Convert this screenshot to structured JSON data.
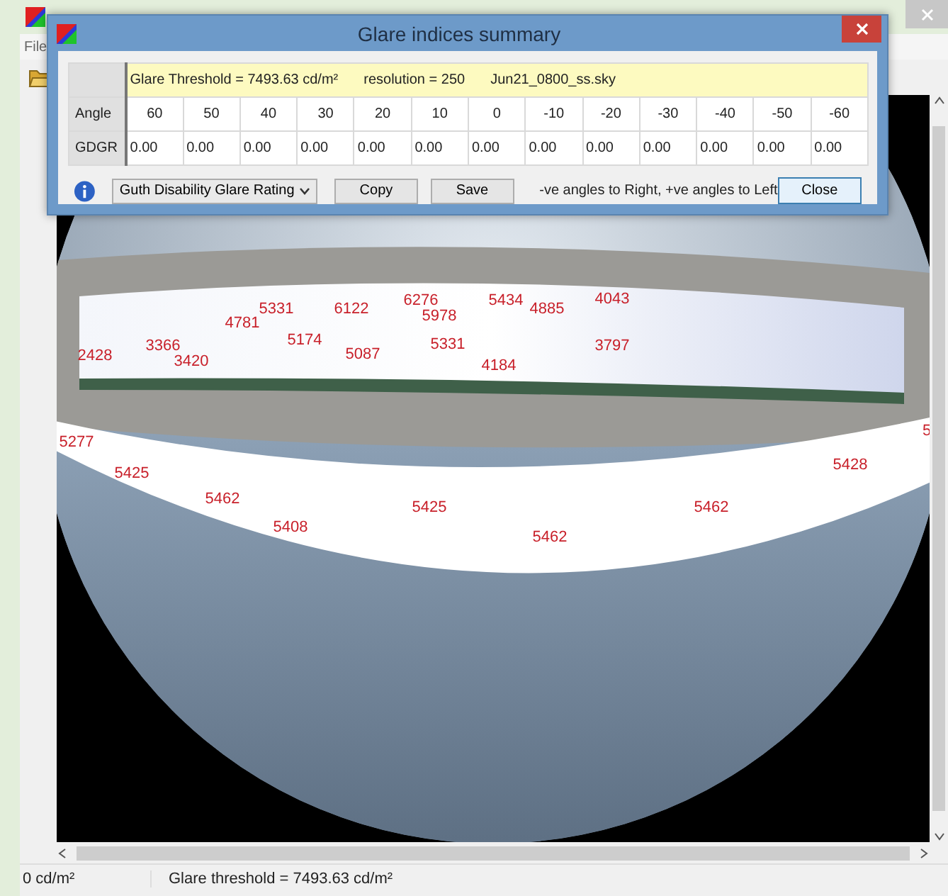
{
  "main_window": {
    "menu": [
      "File"
    ],
    "status_bar": [
      "0 cd/m²",
      "Glare threshold = 7493.63 cd/m²"
    ]
  },
  "fisheye": {
    "labels": [
      "6276",
      "5434",
      "4043",
      "5331",
      "6122",
      "4885",
      "5978",
      "4781",
      "5174",
      "3366",
      "5331",
      "3797",
      "2428",
      "5087",
      "3420",
      "4184",
      "5",
      "5277",
      "5428",
      "5425",
      "5462",
      "5425",
      "5462",
      "5408",
      "5462"
    ]
  },
  "dialog": {
    "title": "Glare indices summary",
    "info": [
      "Glare Threshold = 7493.63 cd/m²",
      "resolution = 250",
      "Jun21_0800_ss.sky"
    ],
    "rows": [
      {
        "header": "Angle",
        "cells": [
          "60",
          "50",
          "40",
          "30",
          "20",
          "10",
          "0",
          "-10",
          "-20",
          "-30",
          "-40",
          "-50",
          "-60"
        ]
      },
      {
        "header": "GDGR",
        "cells": [
          "0.00",
          "0.00",
          "0.00",
          "0.00",
          "0.00",
          "0.00",
          "0.00",
          "0.00",
          "0.00",
          "0.00",
          "0.00",
          "0.00",
          "0.00"
        ]
      }
    ],
    "metric": "Guth Disability Glare Rating",
    "buttons": [
      "Copy",
      "Save"
    ],
    "note": "-ve angles to Right, +ve angles to Left",
    "close_button": "Close"
  }
}
